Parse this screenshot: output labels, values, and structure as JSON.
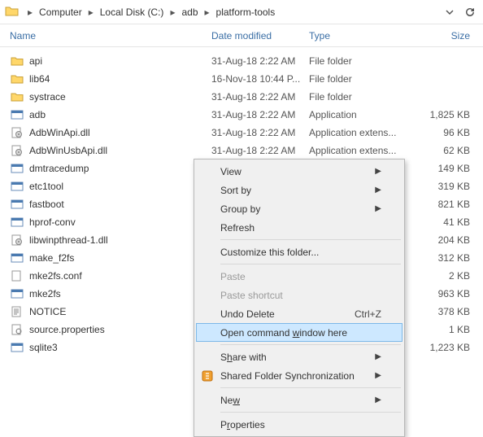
{
  "breadcrumb": {
    "items": [
      "Computer",
      "Local Disk (C:)",
      "adb",
      "platform-tools"
    ]
  },
  "columns": {
    "name": "Name",
    "date": "Date modified",
    "type": "Type",
    "size": "Size"
  },
  "files": [
    {
      "icon": "folder",
      "name": "api",
      "date": "31-Aug-18 2:22 AM",
      "type": "File folder",
      "size": ""
    },
    {
      "icon": "folder",
      "name": "lib64",
      "date": "16-Nov-18 10:44 P...",
      "type": "File folder",
      "size": ""
    },
    {
      "icon": "folder",
      "name": "systrace",
      "date": "31-Aug-18 2:22 AM",
      "type": "File folder",
      "size": ""
    },
    {
      "icon": "exe",
      "name": "adb",
      "date": "31-Aug-18 2:22 AM",
      "type": "Application",
      "size": "1,825 KB"
    },
    {
      "icon": "dll",
      "name": "AdbWinApi.dll",
      "date": "31-Aug-18 2:22 AM",
      "type": "Application extens...",
      "size": "96 KB"
    },
    {
      "icon": "dll",
      "name": "AdbWinUsbApi.dll",
      "date": "31-Aug-18 2:22 AM",
      "type": "Application extens...",
      "size": "62 KB"
    },
    {
      "icon": "exe",
      "name": "dmtracedump",
      "date": "",
      "type": "",
      "size": "149 KB"
    },
    {
      "icon": "exe",
      "name": "etc1tool",
      "date": "",
      "type": "",
      "size": "319 KB"
    },
    {
      "icon": "exe",
      "name": "fastboot",
      "date": "",
      "type": "",
      "size": "821 KB"
    },
    {
      "icon": "exe",
      "name": "hprof-conv",
      "date": "",
      "type": "",
      "size": "41 KB"
    },
    {
      "icon": "dll",
      "name": "libwinpthread-1.dll",
      "date": "",
      "type": "",
      "size": "204 KB"
    },
    {
      "icon": "exe",
      "name": "make_f2fs",
      "date": "",
      "type": "",
      "size": "312 KB"
    },
    {
      "icon": "file",
      "name": "mke2fs.conf",
      "date": "",
      "type": "",
      "size": "2 KB"
    },
    {
      "icon": "exe",
      "name": "mke2fs",
      "date": "",
      "type": "",
      "size": "963 KB"
    },
    {
      "icon": "txt",
      "name": "NOTICE",
      "date": "",
      "type": "",
      "size": "378 KB"
    },
    {
      "icon": "prop",
      "name": "source.properties",
      "date": "",
      "type": "",
      "size": "1 KB"
    },
    {
      "icon": "exe",
      "name": "sqlite3",
      "date": "",
      "type": "",
      "size": "1,223 KB"
    }
  ],
  "ctx": {
    "view": "View",
    "sortby": "Sort by",
    "groupby": "Group by",
    "refresh": "Refresh",
    "customize": "Customize this folder...",
    "paste": "Paste",
    "pasteshortcut": "Paste shortcut",
    "undodelete": "Undo Delete",
    "undodelete_sc": "Ctrl+Z",
    "opencmd_pre": "Open command ",
    "opencmd_u": "w",
    "opencmd_post": "indow here",
    "sharewith_pre": "S",
    "sharewith_u": "h",
    "sharewith_post": "are with",
    "sfs": "Shared Folder Synchronization",
    "new_pre": "Ne",
    "new_u": "w",
    "properties_pre": "P",
    "properties_u": "r",
    "properties_post": "operties"
  }
}
